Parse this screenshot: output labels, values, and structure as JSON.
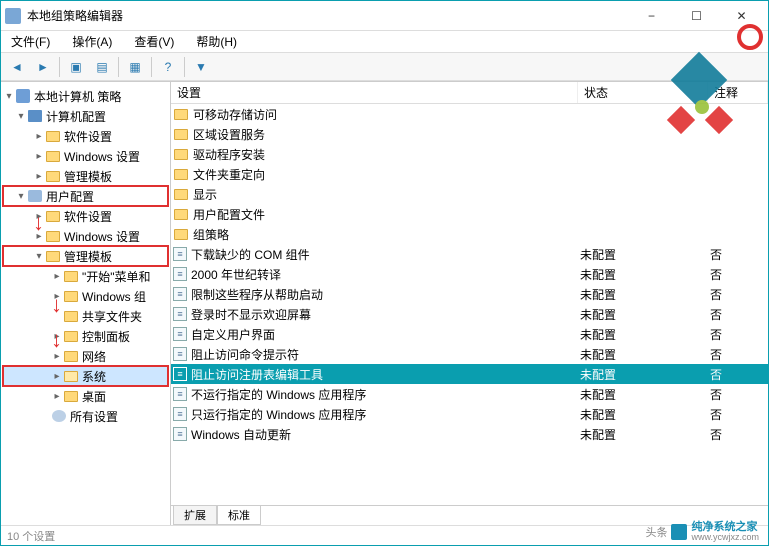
{
  "window": {
    "title": "本地组策略编辑器"
  },
  "menubar": {
    "file": "文件(F)",
    "action": "操作(A)",
    "view": "查看(V)",
    "help": "帮助(H)"
  },
  "tree": {
    "root": "本地计算机 策略",
    "computer_config": "计算机配置",
    "cc_software": "软件设置",
    "cc_windows": "Windows 设置",
    "cc_templates": "管理模板",
    "user_config": "用户配置",
    "uc_software": "软件设置",
    "uc_windows": "Windows 设置",
    "uc_templates": "管理模板",
    "start_menu": "\"开始\"菜单和",
    "windows_comp": "Windows 组",
    "shared_folders": "共享文件夹",
    "control_panel": "控制面板",
    "network": "网络",
    "system": "系统",
    "desktop": "桌面",
    "all_settings": "所有设置"
  },
  "columns": {
    "setting": "设置",
    "state": "状态",
    "comment": "注释"
  },
  "folders": [
    "可移动存储访问",
    "区域设置服务",
    "驱动程序安装",
    "文件夹重定向",
    "显示",
    "用户配置文件",
    "组策略"
  ],
  "settings": [
    {
      "name": "下载缺少的 COM 组件",
      "state": "未配置",
      "comment": "否"
    },
    {
      "name": "2000 年世纪转译",
      "state": "未配置",
      "comment": "否"
    },
    {
      "name": "限制这些程序从帮助启动",
      "state": "未配置",
      "comment": "否"
    },
    {
      "name": "登录时不显示欢迎屏幕",
      "state": "未配置",
      "comment": "否"
    },
    {
      "name": "自定义用户界面",
      "state": "未配置",
      "comment": "否"
    },
    {
      "name": "阻止访问命令提示符",
      "state": "未配置",
      "comment": "否"
    },
    {
      "name": "阻止访问注册表编辑工具",
      "state": "未配置",
      "comment": "否",
      "selected": true
    },
    {
      "name": "不运行指定的 Windows 应用程序",
      "state": "未配置",
      "comment": "否"
    },
    {
      "name": "只运行指定的 Windows 应用程序",
      "state": "未配置",
      "comment": "否"
    },
    {
      "name": "Windows 自动更新",
      "state": "未配置",
      "comment": "否"
    }
  ],
  "tabs": {
    "extended": "扩展",
    "standard": "标准"
  },
  "status": "10 个设置",
  "footer": {
    "brand": "纯净系统之家",
    "url": "www.ycwjxz.com"
  },
  "toutiao": "头条"
}
